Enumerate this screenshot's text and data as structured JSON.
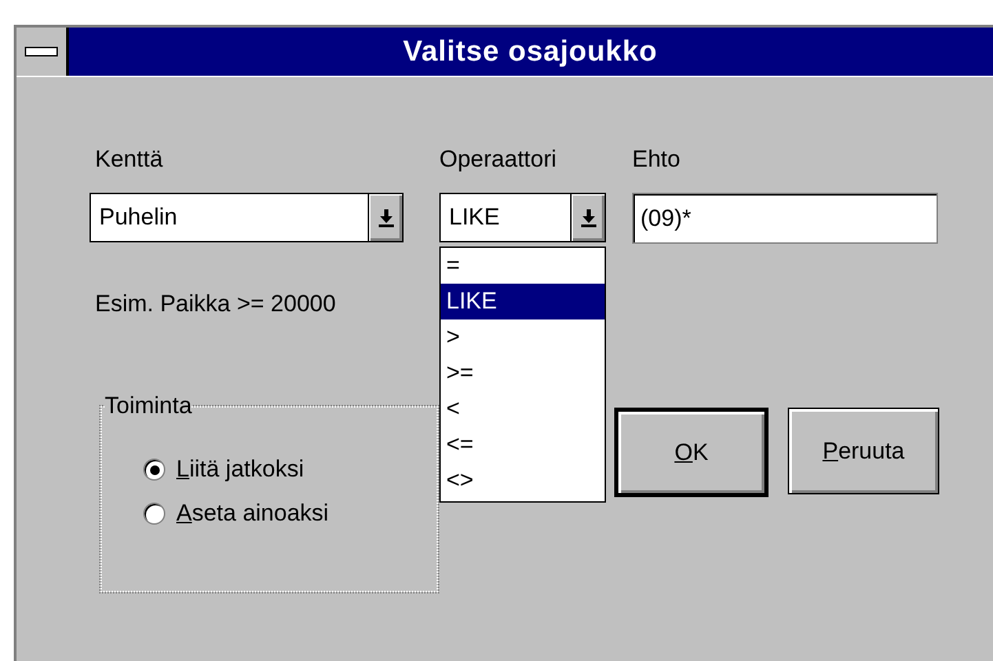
{
  "window": {
    "title": "Valitse osajoukko"
  },
  "field": {
    "label": "Kenttä",
    "value": "Puhelin"
  },
  "operator": {
    "label": "Operaattori",
    "value": "LIKE",
    "expanded": true,
    "options": [
      {
        "label": "=",
        "selected": false
      },
      {
        "label": "LIKE",
        "selected": true
      },
      {
        "label": ">",
        "selected": false
      },
      {
        "label": ">=",
        "selected": false
      },
      {
        "label": "<",
        "selected": false
      },
      {
        "label": "<=",
        "selected": false
      },
      {
        "label": "<>",
        "selected": false
      }
    ]
  },
  "condition": {
    "label": "Ehto",
    "value": "(09)*"
  },
  "hint": "Esim. Paikka >= 20000",
  "action_group": {
    "title": "Toiminta",
    "options": [
      {
        "label": "Liitä jatkoksi",
        "selected": true,
        "underline_first": true
      },
      {
        "label": "Aseta ainoaksi",
        "selected": false,
        "underline_first": true
      }
    ]
  },
  "buttons": [
    {
      "label": "OK",
      "default": true,
      "underline_first": true
    },
    {
      "label": "Peruuta",
      "default": false,
      "underline_first": true
    }
  ]
}
